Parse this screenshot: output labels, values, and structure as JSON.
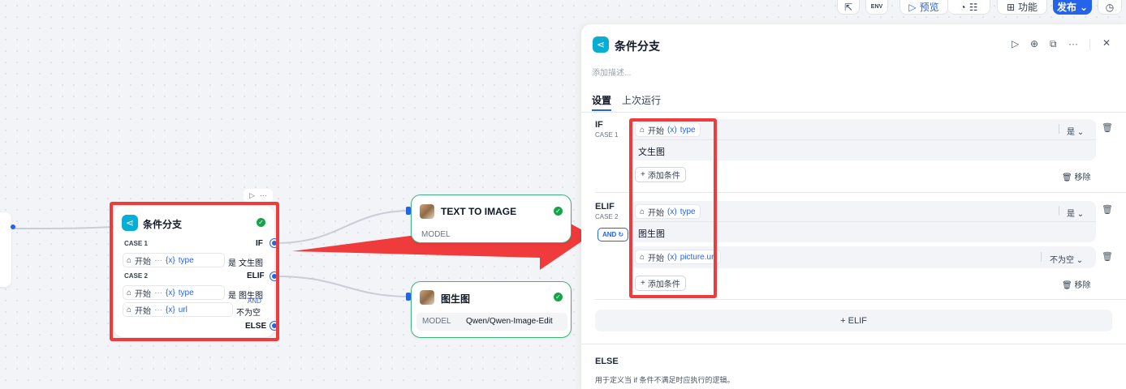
{
  "toolbar": {
    "preview_label": "预览",
    "features_label": "功能",
    "publish_label": "发布",
    "env_label": "ENV"
  },
  "canvas": {
    "if_node": {
      "title": "条件分支",
      "case1_label": "CASE 1",
      "case1_branch": "IF",
      "case1_chip_start": "开始",
      "case1_chip_var": "type",
      "case1_op": "是",
      "case1_value": "文生图",
      "case2_label": "CASE 2",
      "case2_branch": "ELIF",
      "case2_chip1_start": "开始",
      "case2_chip1_var": "type",
      "case2_op1": "是",
      "case2_value1": "图生图",
      "case2_logic": "AND",
      "case2_chip2_start": "开始",
      "case2_chip2_var": "url",
      "case2_op2": "不为空",
      "else_branch": "ELSE"
    },
    "text_to_image_node": {
      "title": "TEXT TO IMAGE",
      "model_label": "MODEL"
    },
    "image_to_image_node": {
      "title": "图生图",
      "model_label": "MODEL",
      "model_value": "Qwen/Qwen-Image-Edit"
    }
  },
  "panel": {
    "title": "条件分支",
    "description_placeholder": "添加描述...",
    "tabs": [
      "设置",
      "上次运行"
    ],
    "if_section": {
      "branch": "IF",
      "case": "CASE 1",
      "chip_start": "开始",
      "chip_var": "type",
      "operator": "是",
      "value": "文生图",
      "add_condition": "添加条件",
      "remove": "移除"
    },
    "elif_section": {
      "branch": "ELIF",
      "case": "CASE 2",
      "logic": "AND",
      "cond1_start": "开始",
      "cond1_var": "type",
      "cond1_operator": "是",
      "cond1_value": "图生图",
      "cond2_start": "开始",
      "cond2_var": "picture.url",
      "cond2_operator": "不为空",
      "add_condition": "添加条件",
      "remove": "移除"
    },
    "add_elif": "+ ELIF",
    "else_section": {
      "title": "ELSE",
      "description": "用于定义当 if 条件不满足时应执行的逻辑。"
    }
  },
  "colors": {
    "accent": "#2563eb",
    "highlight_red": "#ef3b3b",
    "node_green": "#16a34a",
    "node_icon_cyan": "#06aed4"
  }
}
